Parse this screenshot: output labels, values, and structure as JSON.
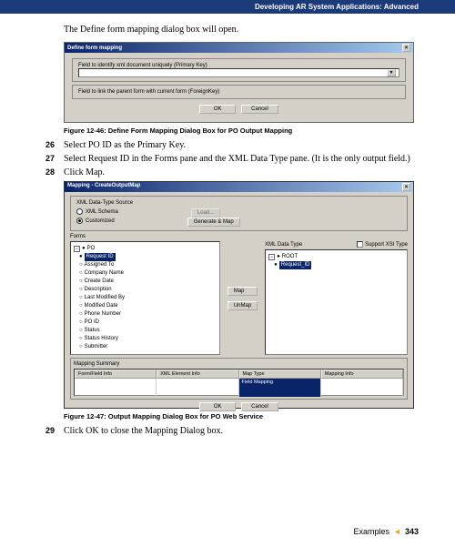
{
  "header": {
    "title": "Developing AR System Applications: Advanced"
  },
  "intro": "The Define form mapping dialog box will open.",
  "dialog1": {
    "title": "Define form mapping",
    "field1_label": "Field to identify xml document uniquely (Primary Key)",
    "field2_label": "Field to link the parent form with current form (ForeignKey)",
    "ok": "OK",
    "cancel": "Cancel"
  },
  "caption1": "Figure 12-46:  Define Form Mapping Dialog Box for PO Output Mapping",
  "steps": {
    "s26_num": "26",
    "s26_text": "Select PO ID as the Primary Key.",
    "s27_num": "27",
    "s27_text": "Select Request ID in the Forms pane and the XML Data Type pane. (It is the only output field.)",
    "s28_num": "28",
    "s28_text": "Click Map.",
    "s29_num": "29",
    "s29_text": "Click OK to close the Mapping Dialog box."
  },
  "dialog2": {
    "title": "Mapping - CreateOutputMap",
    "source_label": "XML Data-Type Source",
    "radio_xml": "XML Schema",
    "radio_custom": "Customized",
    "load_btn": "Load...",
    "gen_btn": "Generate & Map",
    "forms_label": "Forms",
    "xml_label": "XML Data Type",
    "xsi_label": "Support XSI Type",
    "map_btn": "Map",
    "unmap_btn": "UnMap",
    "tree_forms": {
      "root": "PO",
      "items": [
        "Request ID",
        "Assigned To",
        "Company Name",
        "Create Date",
        "Description",
        "Last Modified By",
        "Modified Date",
        "Phone Number",
        "PO ID",
        "Status",
        "Status History",
        "Submitter"
      ]
    },
    "tree_xml": {
      "root": "ROOT",
      "item": "Request_ID"
    },
    "summary_label": "Mapping Summary",
    "summary_headers": [
      "Form/Field Info",
      "XML Element Info",
      "Map Type",
      "Mapping Info"
    ],
    "summary_data": [
      "",
      "",
      "Field Mapping",
      ""
    ],
    "ok": "OK",
    "cancel": "Cancel"
  },
  "caption2": "Figure 12-47:  Output Mapping Dialog Box for PO Web Service",
  "footer": {
    "section": "Examples",
    "page": "343"
  }
}
